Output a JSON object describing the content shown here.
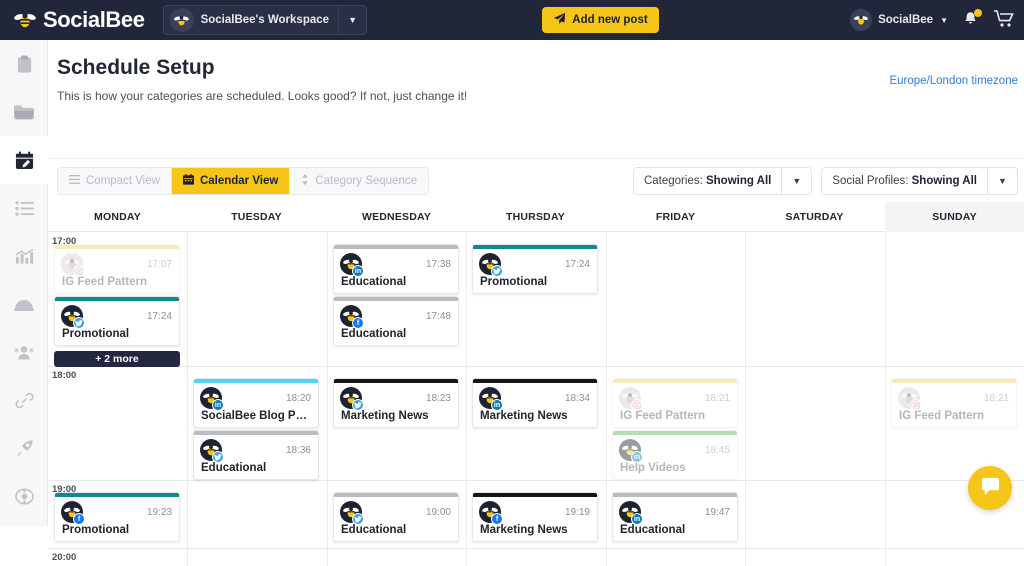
{
  "topbar": {
    "brand": "SocialBee",
    "brand_icon": "bee-logo-icon",
    "workspace": "SocialBee's Workspace",
    "workspace_caret_icon": "chevron-down-icon",
    "add_post_label": "Add new post",
    "add_post_icon": "paper-plane-icon",
    "account_name": "SocialBee",
    "account_caret_icon": "chevron-down-icon",
    "notification_icon": "bell-icon",
    "cart_icon": "shopping-cart-icon",
    "accent_yellow": "#f5c518",
    "bar_color": "#22263a"
  },
  "sidebar": {
    "items": [
      {
        "name": "clipboard-icon",
        "active": false
      },
      {
        "name": "folder-icon",
        "active": false
      },
      {
        "name": "calendar-edit-icon",
        "active": true
      },
      {
        "name": "list-icon",
        "active": false
      },
      {
        "name": "analytics-chart-icon",
        "active": false
      },
      {
        "name": "cloche-icon",
        "active": false
      },
      {
        "name": "users-icon",
        "active": false
      },
      {
        "name": "link-icon",
        "active": false
      },
      {
        "name": "rocket-icon",
        "active": false
      },
      {
        "name": "lifebuoy-icon",
        "active": false
      }
    ]
  },
  "page": {
    "title": "Schedule Setup",
    "subtitle": "This is how your categories are scheduled. Looks good? If not, just change it!",
    "timezone_link": "Europe/London timezone"
  },
  "toolbar": {
    "tabs": [
      {
        "label": "Compact View",
        "icon": "lines-icon",
        "active": false
      },
      {
        "label": "Calendar View",
        "icon": "calendar-icon",
        "active": true
      },
      {
        "label": "Category Sequence",
        "icon": "sort-icon",
        "active": false
      }
    ],
    "filters": [
      {
        "label": "Categories:",
        "value": "Showing All",
        "caret_icon": "caret-down-icon"
      },
      {
        "label": "Social Profiles:",
        "value": "Showing All",
        "caret_icon": "caret-down-icon"
      }
    ]
  },
  "calendar": {
    "days": [
      "MONDAY",
      "TUESDAY",
      "WEDNESDAY",
      "THURSDAY",
      "FRIDAY",
      "SATURDAY",
      "SUNDAY"
    ],
    "highlighted_day": "SUNDAY",
    "time_labels": [
      "17:00",
      "18:00",
      "19:00",
      "20:00"
    ],
    "more_button": {
      "label": "+ 2 more",
      "day": "MONDAY"
    },
    "events": [
      {
        "day": 0,
        "time": "17:07",
        "title": "IG Feed Pattern",
        "network": "instagram",
        "color": "#f2d070",
        "faded": true
      },
      {
        "day": 0,
        "time": "17:24",
        "title": "Promotional",
        "network": "twitter",
        "color": "#0f8a8a",
        "faded": false
      },
      {
        "day": 2,
        "time": "17:38",
        "title": "Educational",
        "network": "linkedin",
        "color": "#b9bcc0",
        "faded": false
      },
      {
        "day": 2,
        "time": "17:48",
        "title": "Educational",
        "network": "facebook",
        "color": "#b9bcc0",
        "faded": false
      },
      {
        "day": 3,
        "time": "17:24",
        "title": "Promotional",
        "network": "twitter",
        "color": "#0f8a8a",
        "faded": false
      },
      {
        "day": 1,
        "time": "18:20",
        "title": "SocialBee Blog Posts",
        "network": "linkedin",
        "color": "#4fd5ef",
        "faded": false
      },
      {
        "day": 1,
        "time": "18:36",
        "title": "Educational",
        "network": "twitter",
        "color": "#b9bcc0",
        "faded": false
      },
      {
        "day": 2,
        "time": "18:23",
        "title": "Marketing News",
        "network": "twitter",
        "color": "#15161c",
        "faded": false
      },
      {
        "day": 3,
        "time": "18:34",
        "title": "Marketing News",
        "network": "linkedin",
        "color": "#15161c",
        "faded": false
      },
      {
        "day": 4,
        "time": "18:21",
        "title": "IG Feed Pattern",
        "network": "instagram",
        "color": "#f2d070",
        "faded": true
      },
      {
        "day": 4,
        "time": "18:45",
        "title": "Help Videos",
        "network": "linkedin",
        "color": "#5cb85c",
        "faded": true
      },
      {
        "day": 6,
        "time": "18:21",
        "title": "IG Feed Pattern",
        "network": "instagram",
        "color": "#f2d070",
        "faded": true
      },
      {
        "day": 0,
        "time": "19:23",
        "title": "Promotional",
        "network": "facebook",
        "color": "#0f8a8a",
        "faded": false
      },
      {
        "day": 2,
        "time": "19:00",
        "title": "Educational",
        "network": "twitter",
        "color": "#b9bcc0",
        "faded": false
      },
      {
        "day": 3,
        "time": "19:19",
        "title": "Marketing News",
        "network": "facebook",
        "color": "#15161c",
        "faded": false
      },
      {
        "day": 4,
        "time": "19:47",
        "title": "Educational",
        "network": "linkedin",
        "color": "#b9bcc0",
        "faded": false
      }
    ]
  },
  "chat": {
    "icon": "chat-bubble-icon",
    "color": "#f5c518"
  }
}
